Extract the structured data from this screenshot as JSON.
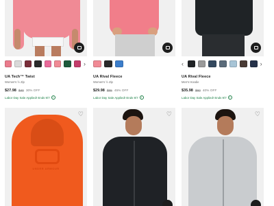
{
  "products": [
    {
      "name": "UA Tech™ Twist",
      "subtitle": "Women's ½ Zip",
      "sale_price": "$27.98",
      "original_price": "$40",
      "discount": "30% OFF",
      "promo": "Labor Day Sale Applied! Ends 9/7",
      "swatches": [
        "#ea7b8c",
        "#d9d9d9",
        "#7a2e3a",
        "#2b2b2b",
        "#e96a9a",
        "#f08a95",
        "#1e5a3c",
        "#c33d6b"
      ]
    },
    {
      "name": "UA Rival Fleece",
      "subtitle": "Women's ½ Zip",
      "sale_price": "$29.98",
      "original_price": "$55",
      "discount": "45% OFF",
      "promo": "Labor Day Sale Applied! Ends 9/7",
      "swatches": [
        "#f08a95",
        "#2b2b2b",
        "#3c7ecb"
      ]
    },
    {
      "name": "UA Rival Fleece",
      "subtitle": "Men's Hoodie",
      "sale_price": "$35.98",
      "original_price": "$60",
      "discount": "40% OFF",
      "promo": "Labor Day Sale Applied! Ends 9/7",
      "swatches": [
        "#202326",
        "#9a9a9a",
        "#34495e",
        "#5b6b7a",
        "#a7c4d6",
        "#4a3b35",
        "#26324a"
      ]
    }
  ],
  "bottom_row": [
    {
      "logo_text": "UNDER ARMOUR"
    },
    {},
    {}
  ],
  "icons": {
    "bag": "shopping-bag-icon",
    "heart": "heart-icon",
    "info": "info-icon",
    "left_arrow": "chevron-left-icon",
    "right_arrow": "chevron-right-icon"
  },
  "glyphs": {
    "left": "‹",
    "right": "›",
    "heart": "♡",
    "info": "i"
  }
}
